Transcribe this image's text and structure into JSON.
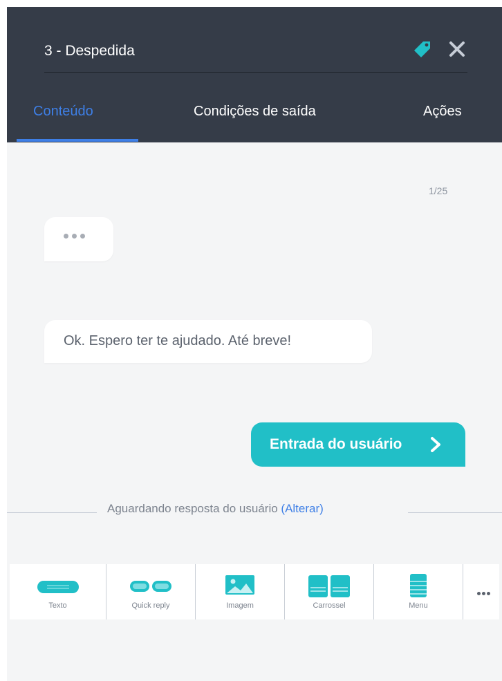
{
  "header": {
    "title": "3 - Despedida",
    "tabs": [
      {
        "label": "Conteúdo",
        "active": true
      },
      {
        "label": "Condições de saída",
        "active": false
      },
      {
        "label": "Ações",
        "active": false
      }
    ]
  },
  "content": {
    "counter": "1/25",
    "message": "Ok. Espero ter te ajudado. Até breve!",
    "user_input_label": "Entrada do usuário",
    "waiting_text": "Aguardando resposta do usuário ",
    "waiting_link": "(Alterar)"
  },
  "toolbar": {
    "items": [
      {
        "label": "Texto",
        "icon": "text-block-icon"
      },
      {
        "label": "Quick reply",
        "icon": "quick-reply-icon"
      },
      {
        "label": "Imagem",
        "icon": "image-icon"
      },
      {
        "label": "Carrossel",
        "icon": "carousel-icon"
      },
      {
        "label": "Menu",
        "icon": "menu-icon"
      }
    ],
    "more_icon": "more-horizontal-icon"
  },
  "colors": {
    "header_bg": "#353c48",
    "accent_blue": "#3e7fe6",
    "teal": "#21bfc7",
    "panel_bg": "#f4f5f6"
  }
}
